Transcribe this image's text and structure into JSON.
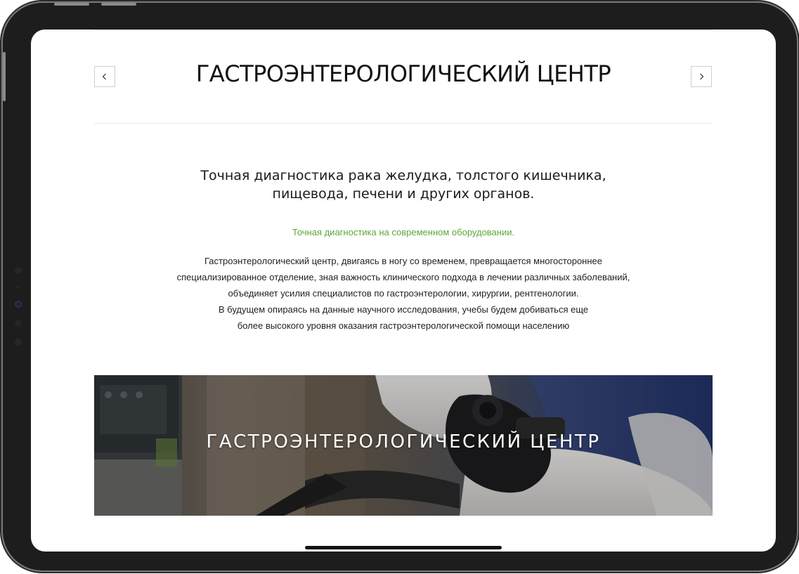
{
  "header": {
    "title": "ГАСТРОЭНТЕРОЛОГИЧЕСКИЙ ЦЕНТР",
    "prev_icon": "chevron-left-icon",
    "next_icon": "chevron-right-icon"
  },
  "intro": {
    "headline_lines": [
      "Точная диагностика рака желудка, толстого кишечника,",
      "пищевода, печени и других органов."
    ],
    "accent": "Точная диагностика на современном оборудовании.",
    "body_lines": [
      "Гастроэнтерологический центр, двигаясь в ногу со временем, превращается многостороннее",
      "специализированное отделение, зная важность клинического подхода в лечении различных заболеваний,",
      "объединяет усилия специалистов по гастроэнтерологии, хирургии, рентгенологии.",
      "В будущем опираясь на данные научного исследования, учебы будем добиваться еще",
      "более высокого уровня оказания гастроэнтерологической помощи населению"
    ]
  },
  "banner": {
    "title": "ГАСТРОЭНТЕРОЛОГИЧЕСКИЙ ЦЕНТР",
    "image": "endoscope-in-gloved-hands-photo"
  },
  "colors": {
    "accent": "#5da63a",
    "text": "#111111",
    "frame": "#1d1d1d"
  }
}
